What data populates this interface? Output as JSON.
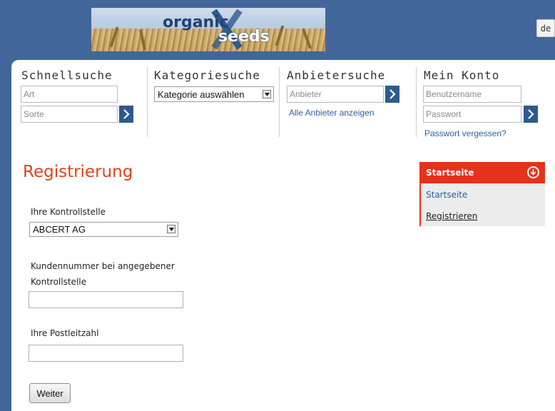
{
  "header": {
    "logo_word_1": "organic",
    "logo_word_2": "seeds",
    "language": "de"
  },
  "search": {
    "quick": {
      "title": "Schnellsuche",
      "art_placeholder": "Art",
      "sorte_placeholder": "Sorte"
    },
    "category": {
      "title": "Kategoriesuche",
      "selected": "Kategorie auswählen"
    },
    "supplier": {
      "title": "Anbietersuche",
      "placeholder": "Anbieter",
      "show_all_link": "Alle Anbieter anzeigen"
    },
    "account": {
      "title": "Mein Konto",
      "username_placeholder": "Benutzername",
      "password_placeholder": "Passwort",
      "forgot_link": "Passwort vergessen?"
    }
  },
  "form": {
    "heading": "Registrierung",
    "control_label": "Ihre Kontrollstelle",
    "control_selected": "ABCERT AG",
    "customer_label": "Kundennummer bei angegebener Kontrollstelle",
    "customer_value": "",
    "zip_label": "Ihre Postleitzahl",
    "zip_value": "",
    "submit_label": "Weiter"
  },
  "sidebar": {
    "header": "Startseite",
    "items": [
      {
        "label": "Startseite"
      },
      {
        "label": "Registrieren"
      }
    ]
  },
  "colors": {
    "accent": "#e5321b",
    "nav_blue": "#2d5a8e",
    "background": "#43669a"
  }
}
